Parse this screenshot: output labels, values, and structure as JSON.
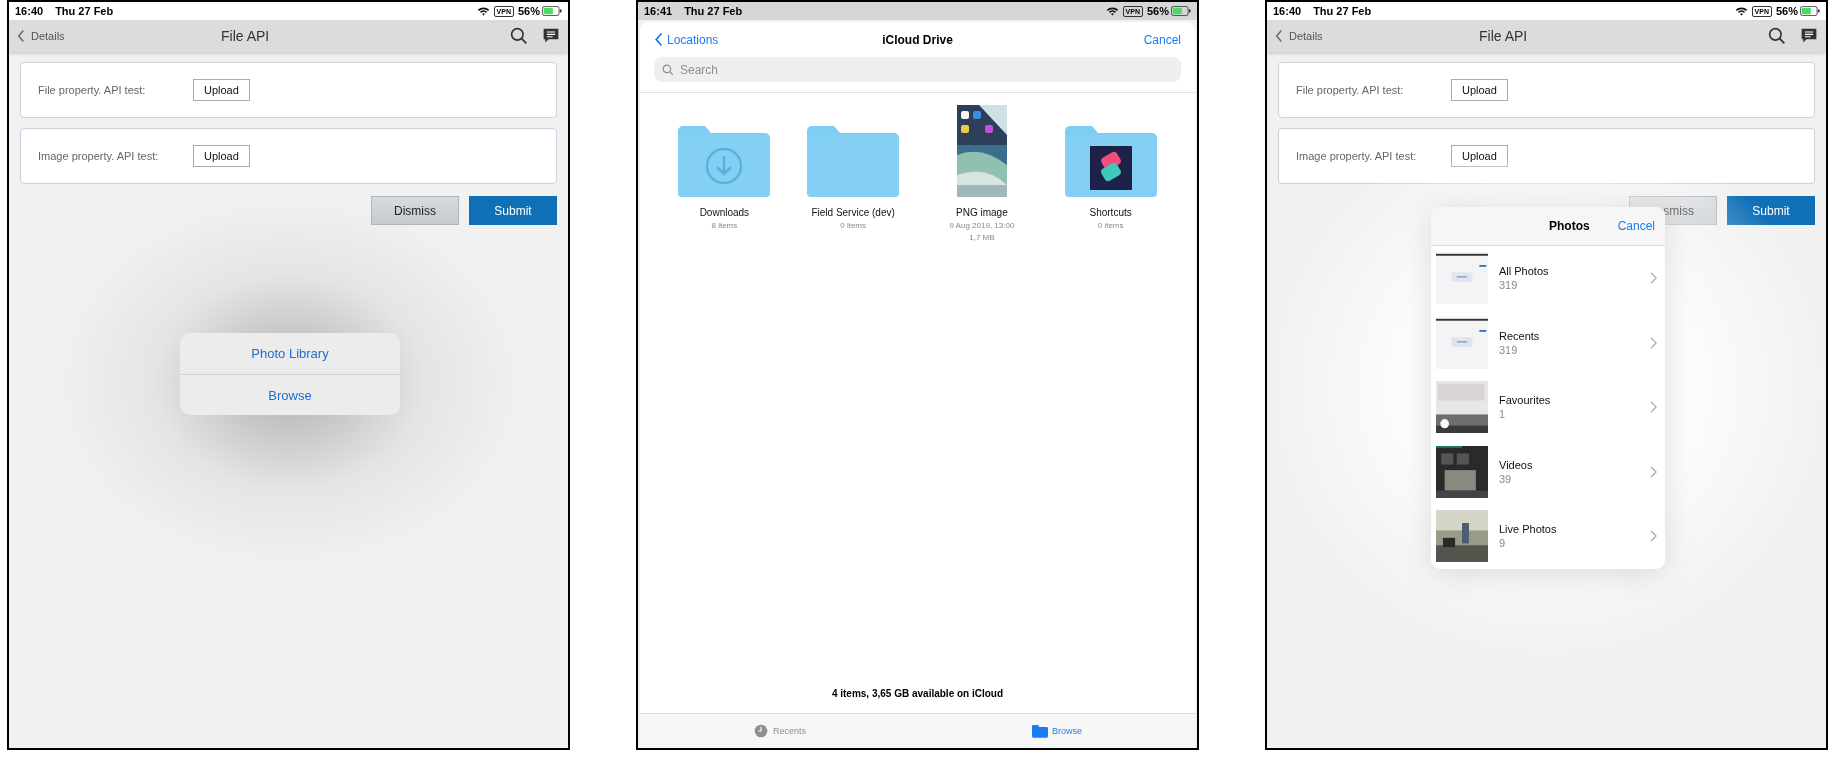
{
  "screens": [
    {
      "kind": "form",
      "status": {
        "time": "16:40",
        "date": "Thu 27 Feb",
        "vpn": "VPN",
        "battery": "56%"
      },
      "nav": {
        "back": "Details",
        "title": "File API"
      },
      "fields": [
        {
          "label": "File property. API test:",
          "button": "Upload"
        },
        {
          "label": "Image property. API test:",
          "button": "Upload"
        }
      ],
      "actions": [
        {
          "label": "Dismiss",
          "kind": "secondary"
        },
        {
          "label": "Submit",
          "kind": "primary"
        }
      ],
      "sheet": {
        "options": [
          "Photo Library",
          "Browse"
        ]
      }
    },
    {
      "kind": "browser",
      "status": {
        "time": "16:41",
        "date": "Thu 27 Feb",
        "vpn": "VPN",
        "battery": "56%"
      },
      "nav": {
        "back": "Locations",
        "title": "iCloud Drive",
        "cancel": "Cancel"
      },
      "search": {
        "placeholder": "Search"
      },
      "items": [
        {
          "kind": "downloads",
          "name": "Downloads",
          "lines": [
            "8 items"
          ]
        },
        {
          "kind": "folder",
          "name": "Field Service (dev)",
          "lines": [
            "0 items"
          ]
        },
        {
          "name": "PNG image",
          "lines": [
            "9 Aug 2019, 13:00",
            "1,7 MB"
          ]
        },
        {
          "kind": "appfolder",
          "name": "Shortcuts",
          "lines": [
            "0 items"
          ]
        }
      ],
      "footer": "4 items, 3,65 GB available on iCloud",
      "tabs": [
        {
          "label": "Recents",
          "kind": "clock",
          "selected": false
        },
        {
          "label": "Browse",
          "kind": "folder",
          "selected": true
        }
      ]
    },
    {
      "kind": "form",
      "status": {
        "time": "16:40",
        "date": "Thu 27 Feb",
        "vpn": "VPN",
        "battery": "56%"
      },
      "nav": {
        "back": "Details",
        "title": "File API"
      },
      "fields": [
        {
          "label": "File property. API test:",
          "button": "Upload"
        },
        {
          "label": "Image property. API test:",
          "button": "Upload"
        }
      ],
      "actions": [
        {
          "label": "smiss",
          "kind": "secondary"
        },
        {
          "label": "Submit",
          "kind": "primary"
        }
      ],
      "popover": {
        "title": "Photos",
        "cancel": "Cancel",
        "albums": [
          {
            "name": "All Photos",
            "count": "319"
          },
          {
            "name": "Recents",
            "count": "319"
          },
          {
            "name": "Favourites",
            "count": "1"
          },
          {
            "name": "Videos",
            "count": "39"
          },
          {
            "name": "Live Photos",
            "count": "9"
          }
        ]
      }
    }
  ]
}
